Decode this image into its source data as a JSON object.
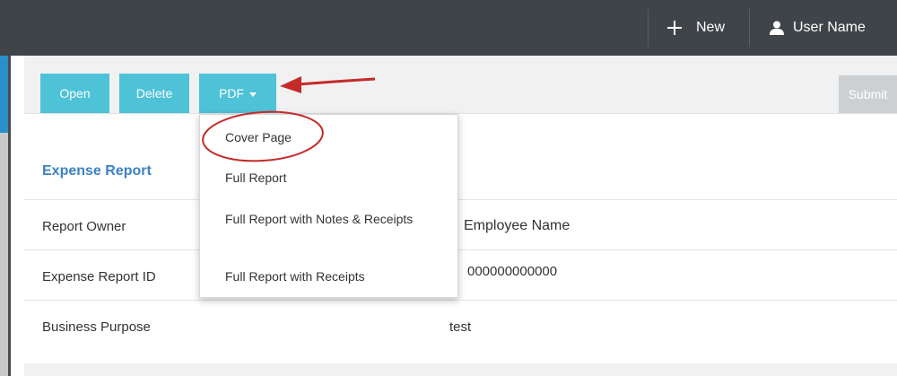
{
  "header": {
    "new_label": "New",
    "user_label": "User Name"
  },
  "toolbar": {
    "open_label": "Open",
    "delete_label": "Delete",
    "pdf_label": "PDF",
    "submit_label": "Submit"
  },
  "pdf_menu": {
    "items": [
      {
        "label": "Cover Page"
      },
      {
        "label": "Full Report"
      },
      {
        "label": "Full Report with Notes & Receipts"
      },
      {
        "label": "Full Report with Receipts"
      }
    ]
  },
  "report": {
    "title": "Expense Report",
    "fields": [
      {
        "label": "Report Owner",
        "value": "Employee Name"
      },
      {
        "label": "Expense Report ID",
        "value": "000000000000"
      },
      {
        "label": "Business Purpose",
        "value": "test"
      }
    ]
  },
  "colors": {
    "topbar": "#3f4449",
    "button": "#4ec2d7",
    "title": "#3b82c4",
    "annotation": "#c42a2a"
  },
  "icons": {
    "new": "plus-icon",
    "user": "user-icon",
    "dropdown": "caret-down-icon"
  }
}
